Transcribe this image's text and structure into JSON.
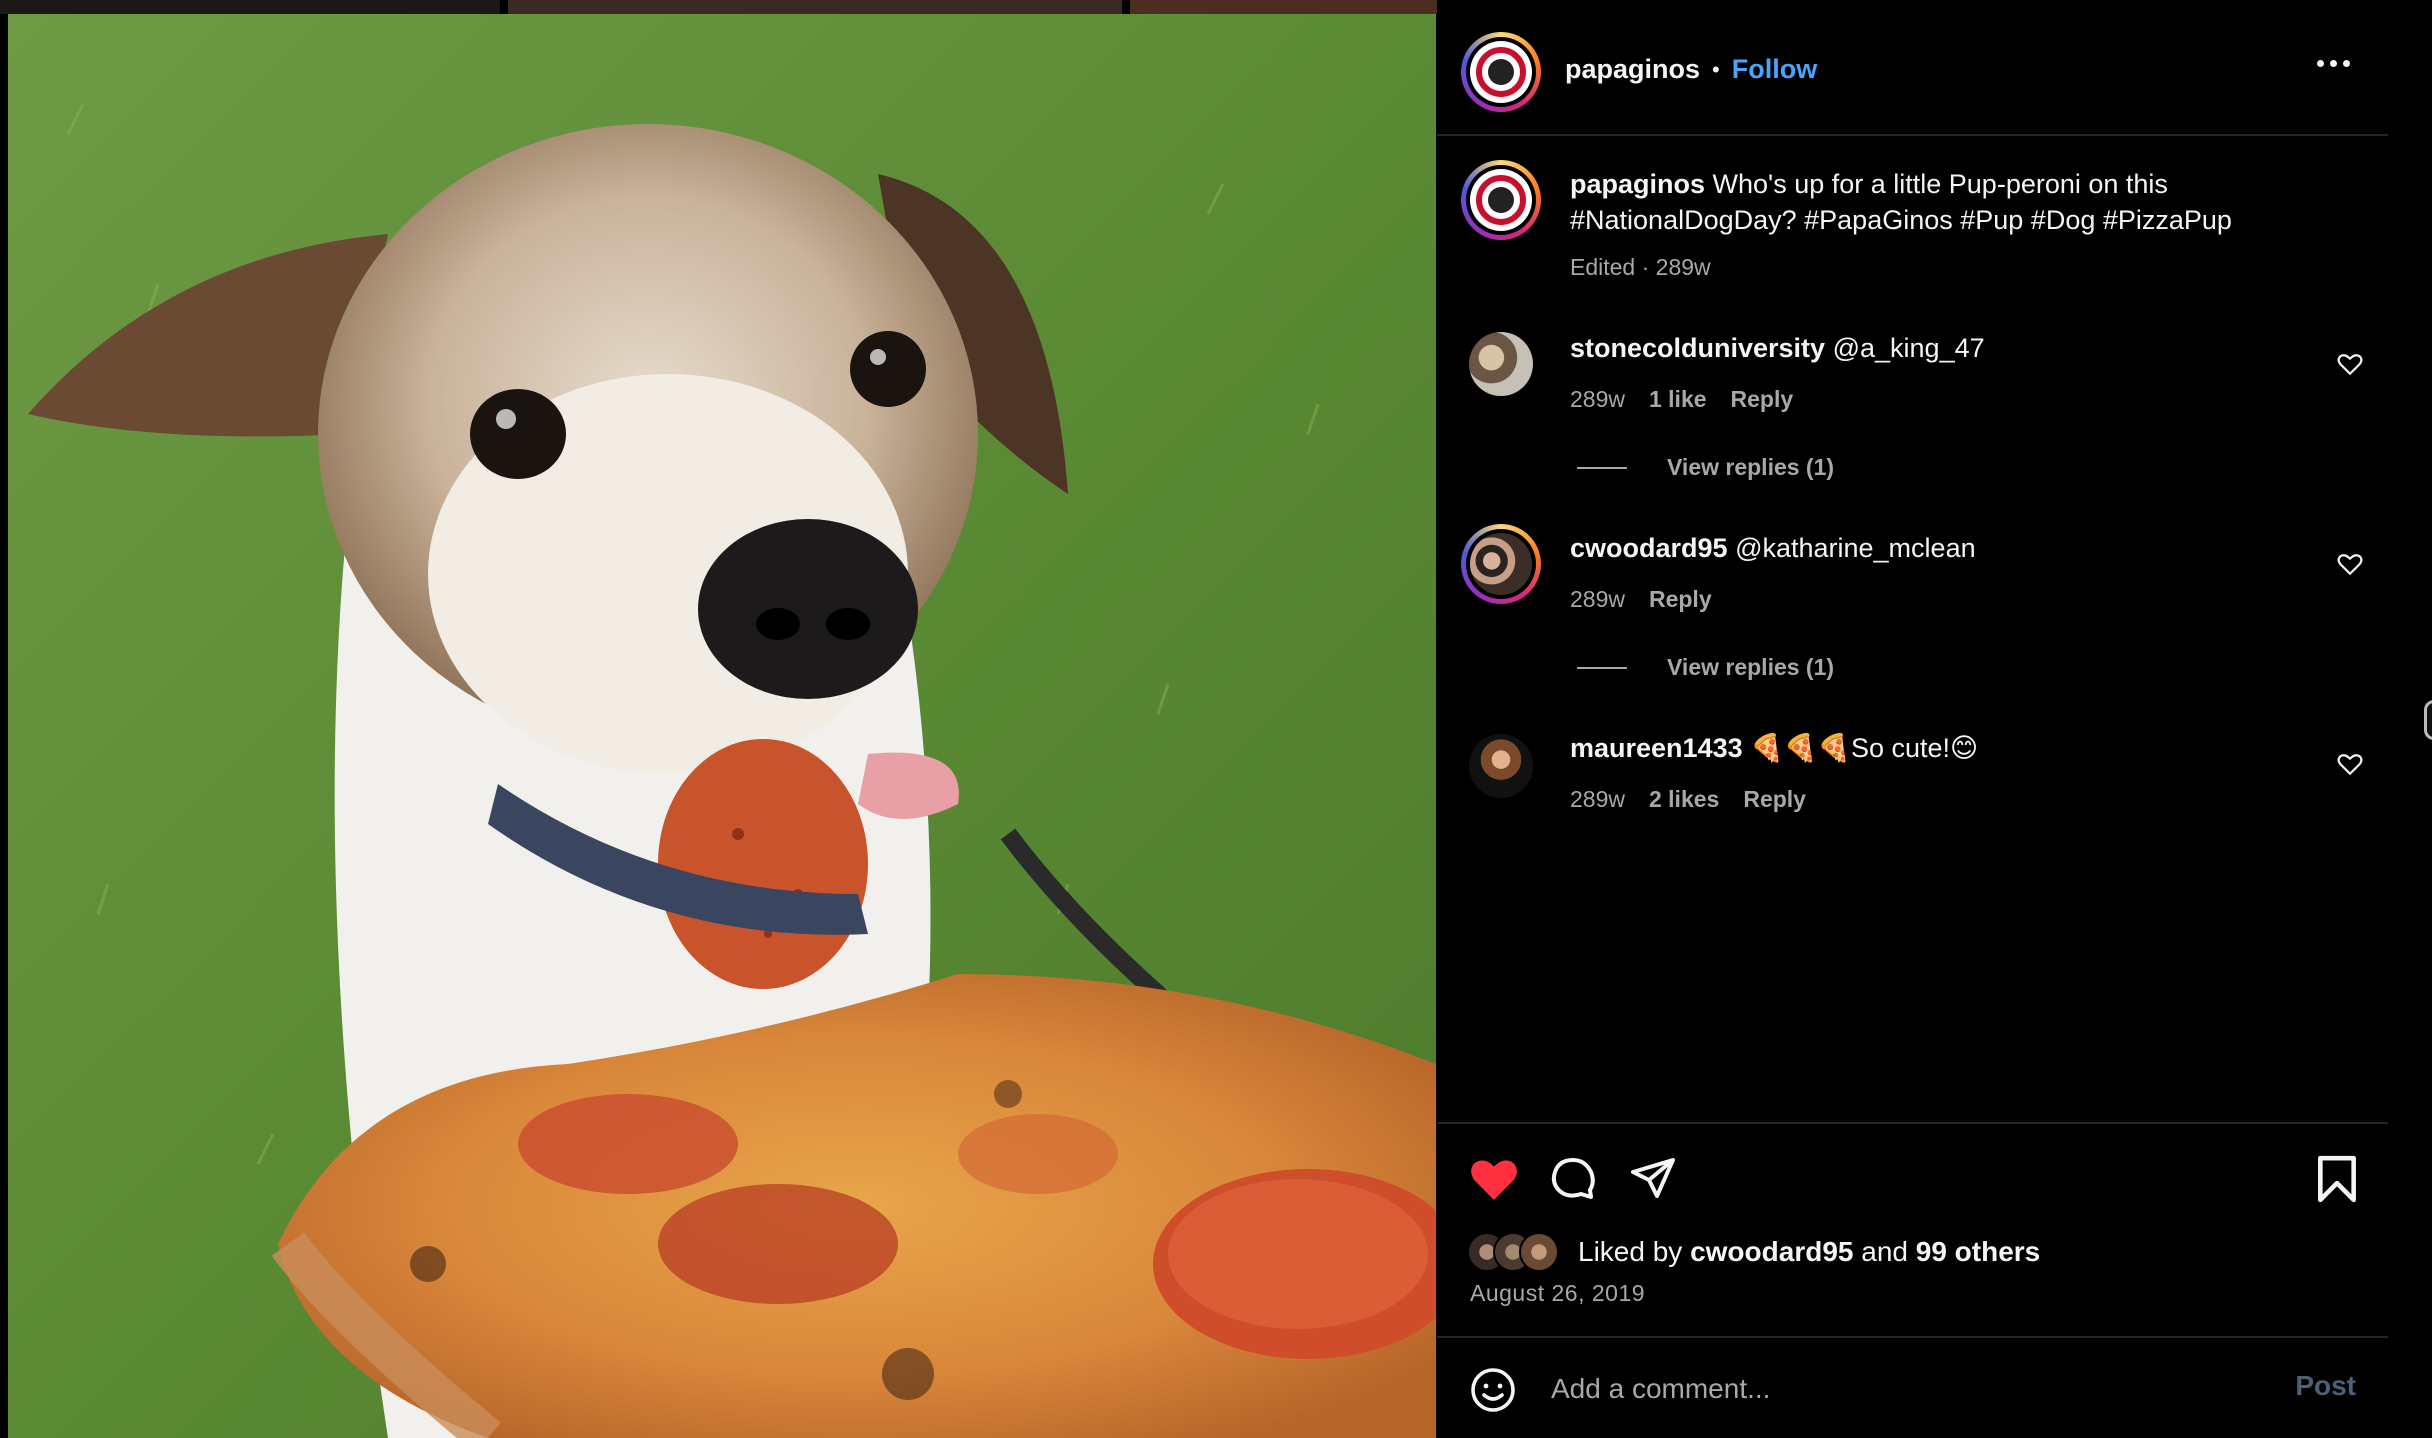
{
  "post": {
    "account": "papaginos",
    "follow_label": "Follow",
    "separator": "•",
    "caption_user": "papaginos",
    "caption_text": "Who's up for a little Pup-peroni on this #NationalDogDay? #PapaGinos #Pup #Dog #PizzaPup",
    "caption_meta": "Edited · 289w"
  },
  "comments": [
    {
      "user": "stonecolduniversity",
      "text": "@a_king_47",
      "age": "289w",
      "likes": "1 like",
      "reply_label": "Reply",
      "view_replies": "View replies (1)"
    },
    {
      "user": "cwoodard95",
      "text": "@katharine_mclean",
      "age": "289w",
      "likes": "",
      "reply_label": "Reply",
      "view_replies": "View replies (1)"
    },
    {
      "user": "maureen1433",
      "text": "🍕🍕🍕So cute!😊",
      "age": "289w",
      "likes": "2 likes",
      "reply_label": "Reply",
      "view_replies": ""
    }
  ],
  "likes": {
    "prefix": "Liked by",
    "user": "cwoodard95",
    "middle": "and",
    "others": "99 others",
    "date": "August 26, 2019"
  },
  "composer": {
    "placeholder": "Add a comment...",
    "post_label": "Post"
  },
  "icons": {
    "like": "heart-filled-icon",
    "comment": "comment-bubble-icon",
    "share": "paper-plane-icon",
    "save": "bookmark-icon",
    "emoji": "smiley-icon",
    "more": "more-horizontal-icon",
    "comment_like": "heart-outline-icon"
  },
  "colors": {
    "like_red": "#ff3040",
    "follow_blue": "#4aa3ff",
    "post_disabled": "#4b6079",
    "muted": "#a8a8a8",
    "divider": "#262626"
  }
}
